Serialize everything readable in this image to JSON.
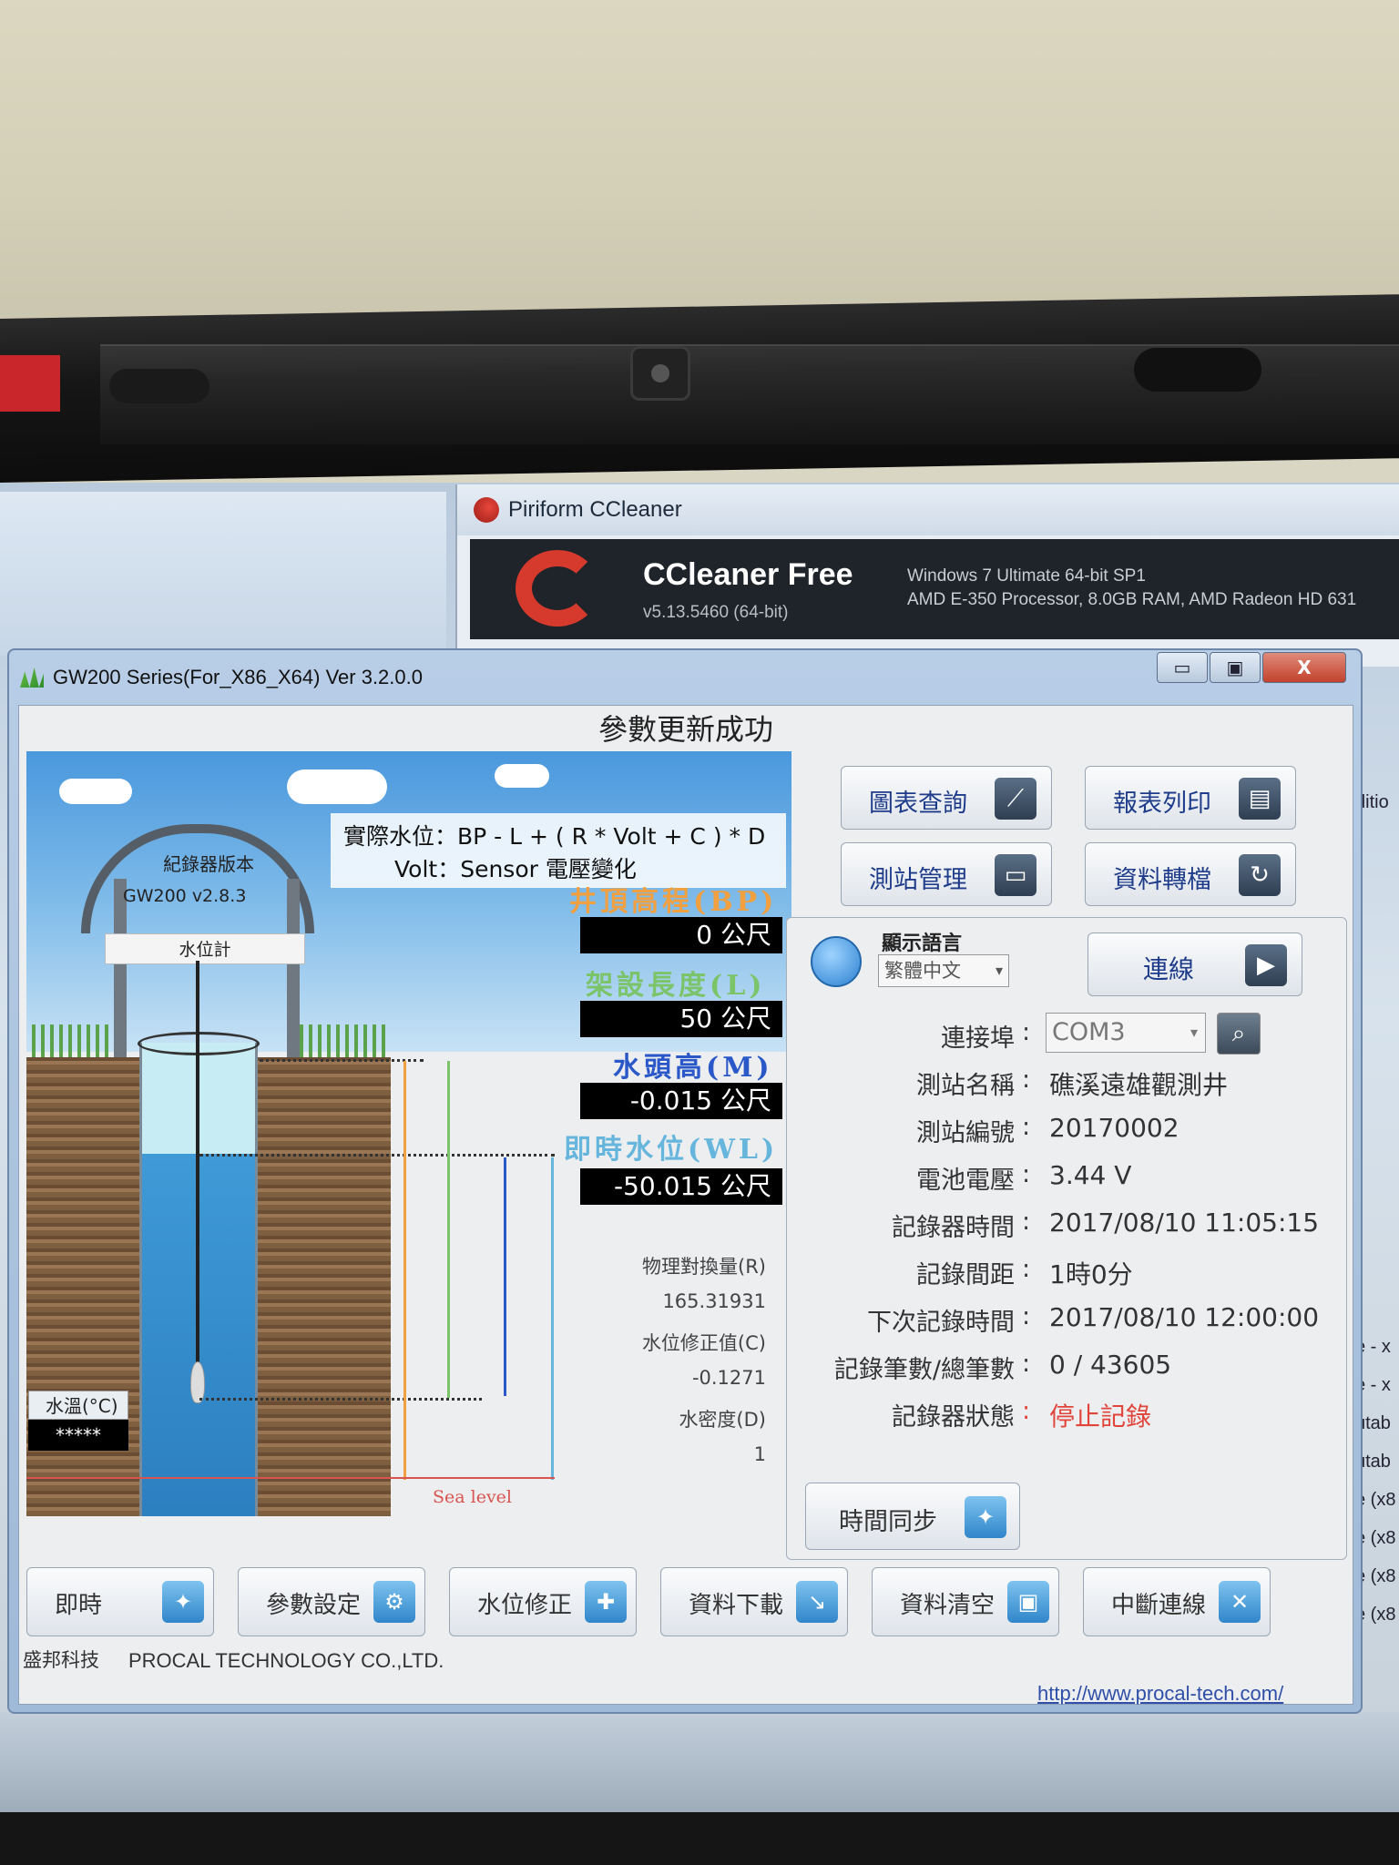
{
  "ccleaner": {
    "window_title": "Piriform CCleaner",
    "product_name": "CCleaner Free",
    "version": "v5.13.5460 (64-bit)",
    "system_line1": "Windows 7 Ultimate 64-bit SP1",
    "system_line2": "AMD E-350 Processor, 8.0GB RAM, AMD Radeon HD 631"
  },
  "edge_texts": [
    "ditio",
    "e - x",
    "e - x",
    "utab",
    "utab",
    "e (x8",
    "e (x8",
    "e (x8",
    "e (x8"
  ],
  "gw": {
    "title": "GW200 Series(For_X86_X64)   Ver 3.2.0.0",
    "window_buttons": {
      "minimize": "▭",
      "maximize": "▣",
      "close": "X"
    },
    "status": "參數更新成功",
    "formula_line1": "實際水位：BP - L + ( R * Volt + C ) * D",
    "formula_line2": "Volt：Sensor 電壓變化",
    "logger_label": "紀錄器版本",
    "logger_version": "GW200 v2.8.3",
    "meter_label": "水位計",
    "temp_label": "水溫(°C)",
    "temp_value": "*****",
    "sea_level": "Sea level",
    "params": [
      {
        "title": "井頂高程(BP)",
        "value": "0 公尺",
        "color": "#f0a040"
      },
      {
        "title": "架設長度(L)",
        "value": "50 公尺",
        "color": "#7cc46a"
      },
      {
        "title": "水頭高(M)",
        "value": "-0.015 公尺",
        "color": "#2a58c8"
      },
      {
        "title": "即時水位(WL)",
        "value": "-50.015 公尺",
        "color": "#66b5dc"
      }
    ],
    "calc": {
      "r_label": "物理對換量(R)",
      "r_value": "165.31931",
      "c_label": "水位修正值(C)",
      "c_value": "-0.1271",
      "d_label": "水密度(D)",
      "d_value": "1"
    },
    "top_buttons": [
      {
        "label": "圖表查詢",
        "icon": "chart-icon",
        "glyph": "⟋"
      },
      {
        "label": "報表列印",
        "icon": "report-icon",
        "glyph": "▤"
      },
      {
        "label": "測站管理",
        "icon": "station-icon",
        "glyph": "▭"
      },
      {
        "label": "資料轉檔",
        "icon": "convert-icon",
        "glyph": "↻"
      }
    ],
    "settings": {
      "language_label": "顯示語言",
      "language_value": "繁體中文",
      "connect_label": "連線",
      "port_label": "連接埠",
      "port_value": "COM3",
      "station_name_label": "測站名稱",
      "station_name": "礁溪遠雄觀測井",
      "station_no_label": "測站編號",
      "station_no": "20170002",
      "battery_label": "電池電壓",
      "battery": "3.44 V",
      "logger_time_label": "記錄器時間",
      "logger_time": "2017/08/10 11:05:15",
      "interval_label": "記錄間距",
      "interval": "1時0分",
      "next_time_label": "下次記錄時間",
      "next_time": "2017/08/10 12:00:00",
      "count_label": "記錄筆數/總筆數",
      "count": "0 / 43605",
      "state_label": "記錄器狀態",
      "state": "停止記錄",
      "state_color": "#e0443a",
      "sync_label": "時間同步"
    },
    "bottom_buttons": [
      {
        "label": "即時",
        "icon": "realtime-icon",
        "glyph": "✦"
      },
      {
        "label": "參數設定",
        "icon": "settings-icon",
        "glyph": "⚙"
      },
      {
        "label": "水位修正",
        "icon": "water-adjust-icon",
        "glyph": "✚"
      },
      {
        "label": "資料下載",
        "icon": "download-icon",
        "glyph": "↘"
      },
      {
        "label": "資料清空",
        "icon": "clear-icon",
        "glyph": "▣"
      },
      {
        "label": "中斷連線",
        "icon": "disconnect-icon",
        "glyph": "✕"
      }
    ],
    "footer_company_cn": "盛邦科技",
    "footer_company_en": "PROCAL TECHNOLOGY CO.,LTD.",
    "footer_url": "http://www.procal-tech.com/"
  }
}
